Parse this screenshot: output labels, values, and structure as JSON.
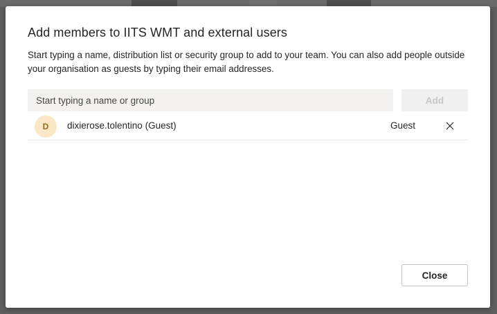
{
  "dialog": {
    "title": "Add members to IITS WMT and external users",
    "description": "Start typing a name, distribution list or security group to add to your team. You can also add people outside your organisation as guests by typing their email addresses."
  },
  "search": {
    "value": "",
    "placeholder": "Start typing a name or group"
  },
  "add_button": {
    "label": "Add",
    "state": "disabled"
  },
  "members": [
    {
      "avatar_initial": "D",
      "avatar_color": "#fbe7c6",
      "name": "dixierose.tolentino (Guest)",
      "role": "Guest",
      "remove_icon": "close-icon"
    }
  ],
  "close_button": {
    "label": "Close"
  }
}
